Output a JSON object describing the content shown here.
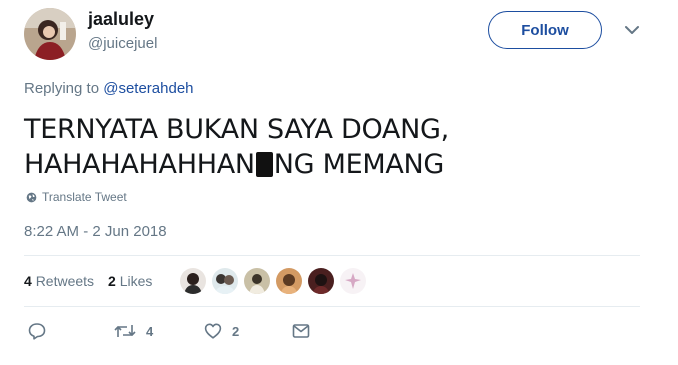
{
  "author": {
    "name": "jaaluley",
    "handle": "@juicejuel"
  },
  "follow_label": "Follow",
  "reply_context": {
    "prefix": "Replying to",
    "mention": "@seterahdeh"
  },
  "tweet": {
    "line1": "TERNYATA BUKAN SAYA DOANG,",
    "line2_before": "HAHAHAHAHHAN",
    "line2_after": "NG MEMANG"
  },
  "translate_label": "Translate Tweet",
  "timestamp": "8:22 AM - 2 Jun 2018",
  "stats": {
    "retweets_count": "4",
    "retweets_label": "Retweets",
    "likes_count": "2",
    "likes_label": "Likes"
  },
  "actions": {
    "retweet_count": "4",
    "like_count": "2"
  },
  "colors": {
    "link": "#1d4ea0",
    "muted": "#657786",
    "text": "#14171a"
  },
  "icons": [
    "globe-icon",
    "chevron-down-icon",
    "reply-icon",
    "retweet-icon",
    "heart-icon",
    "message-icon"
  ]
}
